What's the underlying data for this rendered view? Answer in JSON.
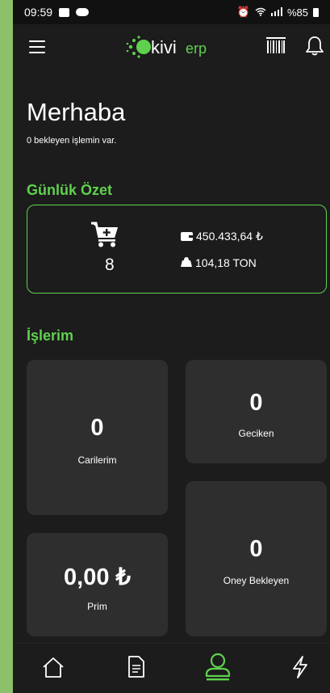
{
  "status_bar": {
    "time": "09:59",
    "battery": "%85"
  },
  "header": {
    "logo_text_kivi": "kivi",
    "logo_text_erp": "erp"
  },
  "greeting": {
    "title": "Merhaba",
    "subtitle": "0 bekleyen işlemin var."
  },
  "daily_summary": {
    "title": "Günlük Özet",
    "cart_count": "8",
    "amount": "450.433,64 ₺",
    "weight": "104,18 TON"
  },
  "operations": {
    "title": "İşlerim",
    "cards": [
      {
        "value": "0",
        "label": "Carilerim"
      },
      {
        "value": "0",
        "label": "Geciken"
      },
      {
        "value": "0",
        "label": "Oney Bekleyen"
      },
      {
        "value": "0,00 ₺",
        "label": "Prim"
      }
    ]
  },
  "colors": {
    "accent": "#5fd14e",
    "background": "#1c1c1c",
    "card": "#2e2e2e"
  },
  "icons": {
    "menu": "hamburger-icon",
    "barcode": "barcode-icon",
    "bell": "bell-icon",
    "cart": "cart-plus-icon",
    "wallet": "wallet-icon",
    "weight": "weight-icon",
    "nav": [
      "home-icon",
      "document-icon",
      "user-icon",
      "lightning-icon"
    ]
  }
}
